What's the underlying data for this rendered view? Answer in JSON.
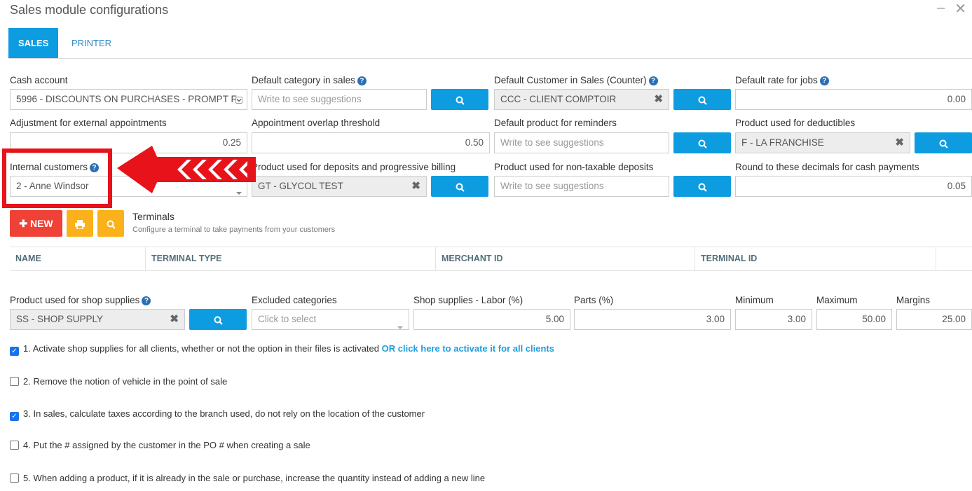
{
  "window": {
    "title": "Sales module configurations",
    "minimize": "–",
    "close": "✕"
  },
  "tabs": [
    "SALES",
    "PRINTER"
  ],
  "fields": {
    "cash_account": {
      "label": "Cash account",
      "value": "5996 - DISCOUNTS ON PURCHASES - PROMPT F"
    },
    "default_category": {
      "label": "Default category in sales",
      "placeholder": "Write to see suggestions"
    },
    "default_customer": {
      "label": "Default Customer in Sales (Counter)",
      "value": "CCC - CLIENT COMPTOIR"
    },
    "default_rate": {
      "label": "Default rate for jobs",
      "value": "0.00"
    },
    "adjust_external": {
      "label": "Adjustment for external appointments",
      "value": "0.25"
    },
    "overlap_threshold": {
      "label": "Appointment overlap threshold",
      "value": "0.50"
    },
    "default_product_reminders": {
      "label": "Default product for reminders",
      "placeholder": "Write to see suggestions"
    },
    "product_deductibles": {
      "label": "Product used for deductibles",
      "value": "F - LA FRANCHISE"
    },
    "internal_customers": {
      "label": "Internal customers",
      "value": "2 - Anne Windsor"
    },
    "product_deposits": {
      "label": "Product used for deposits and progressive billing",
      "value": "GT - GLYCOL TEST"
    },
    "product_nontaxable": {
      "label": "Product used for non-taxable deposits",
      "placeholder": "Write to see suggestions"
    },
    "round_decimals": {
      "label": "Round to these decimals for cash payments",
      "value": "0.05"
    }
  },
  "terminals": {
    "new_label": "NEW",
    "title": "Terminals",
    "subtitle": "Configure a terminal to take payments from your customers",
    "columns": [
      "NAME",
      "TERMINAL TYPE",
      "MERCHANT ID",
      "TERMINAL ID"
    ]
  },
  "shop": {
    "product_label": "Product used for shop supplies",
    "product_value": "SS - SHOP SUPPLY",
    "excluded_label": "Excluded categories",
    "excluded_placeholder": "Click to select",
    "labor_label": "Shop supplies - Labor (%)",
    "labor_value": "5.00",
    "parts_label": "Parts (%)",
    "parts_value": "3.00",
    "min_label": "Minimum",
    "min_value": "3.00",
    "max_label": "Maximum",
    "max_value": "50.00",
    "margins_label": "Margins",
    "margins_value": "25.00"
  },
  "options": [
    {
      "text": "1. Activate shop supplies for all clients, whether or not the option in their files is activated",
      "link": "OR click here to activate it for all clients",
      "checked": true
    },
    {
      "text": "2. Remove the notion of vehicle in the point of sale",
      "checked": false
    },
    {
      "text": "3. In sales, calculate taxes according to the branch used, do not rely on the location of the customer",
      "checked": true
    },
    {
      "text": "4. Put the # assigned by the customer in the PO # when creating a sale",
      "checked": false
    },
    {
      "text": "5. When adding a product, if it is already in the sale or purchase, increase the quantity instead of adding a new line",
      "checked": false
    }
  ],
  "colors": {
    "primary": "#0e9ce0",
    "danger": "#ef4136",
    "warning": "#fbb11a",
    "highlight": "#e8121a"
  }
}
